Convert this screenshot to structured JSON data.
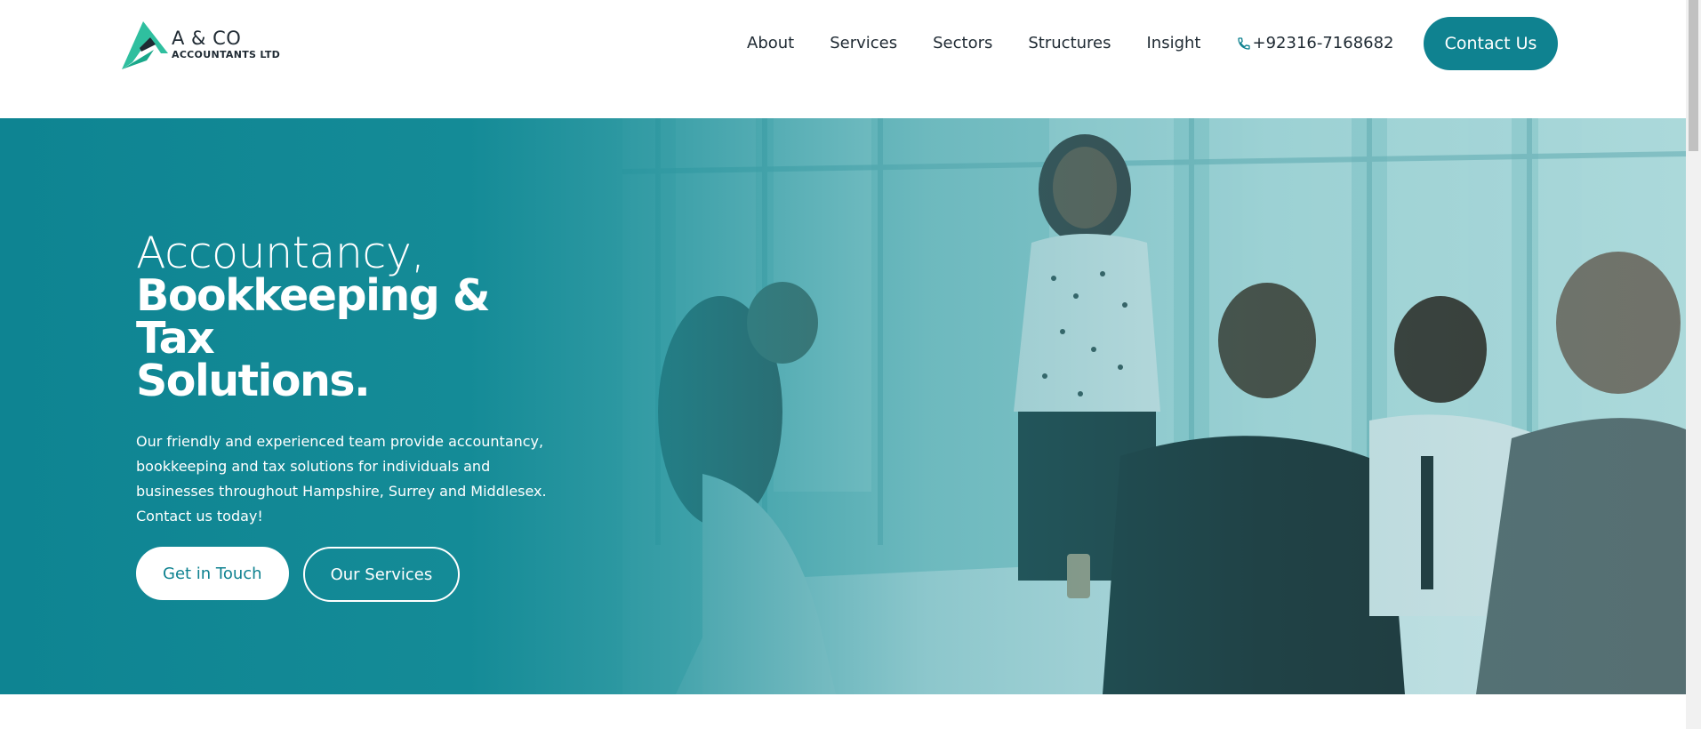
{
  "brand": {
    "name": "A & CO",
    "subtitle": "ACCOUNTANTS LTD",
    "logo_icon": "triangle-a-logo-icon",
    "colors": {
      "primary": "#0f8290",
      "logo_green": "#2fbf9f",
      "text": "#1f2a33"
    }
  },
  "nav": {
    "items": [
      {
        "label": "About"
      },
      {
        "label": "Services"
      },
      {
        "label": "Sectors"
      },
      {
        "label": "Structures"
      },
      {
        "label": "Insight"
      }
    ],
    "phone": "+92316-7168682",
    "phone_icon": "phone-icon",
    "contact_label": "Contact Us"
  },
  "hero": {
    "title_light": "Accountancy,",
    "title_bold_line1": "Bookkeeping & Tax",
    "title_bold_line2": "Solutions.",
    "description": "Our friendly and experienced team provide accountancy, bookkeeping and tax solutions for individuals and businesses throughout Hampshire, Surrey and Middlesex. Contact us today!",
    "primary_button": "Get in Touch",
    "secondary_button": "Our Services"
  }
}
